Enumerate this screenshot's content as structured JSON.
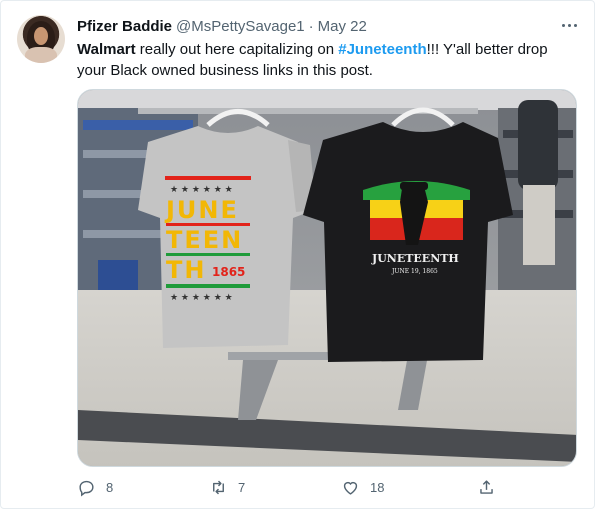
{
  "tweet": {
    "display_name": "Pfizer Baddie",
    "handle": "@MsPettySavage1",
    "separator": "·",
    "date": "May 22",
    "text": {
      "mention": "Walmart",
      "part1": " really out here capitalizing on ",
      "hashtag": "#Juneteenth",
      "part2": "!!! Y'all better drop your Black owned business links in this post."
    }
  },
  "media": {
    "left_shirt": {
      "lines": [
        "JUNE",
        "TEEN",
        "TH"
      ],
      "year": "1865",
      "colors": {
        "shirt": "#c4c4c4",
        "red": "#e2231a",
        "yellow": "#f5c400",
        "green": "#1f9b3a",
        "text": "#f2b705"
      }
    },
    "right_shirt": {
      "title": "JUNETEENTH",
      "subtitle": "JUNE 19, 1865",
      "colors": {
        "shirt": "#1b1b1d",
        "red": "#d9261c",
        "yellow": "#f7d117",
        "green": "#27a13f"
      }
    }
  },
  "actions": {
    "reply_count": "8",
    "retweet_count": "7",
    "like_count": "18"
  },
  "icons": [
    "more-icon",
    "reply-icon",
    "retweet-icon",
    "like-icon",
    "share-icon"
  ]
}
